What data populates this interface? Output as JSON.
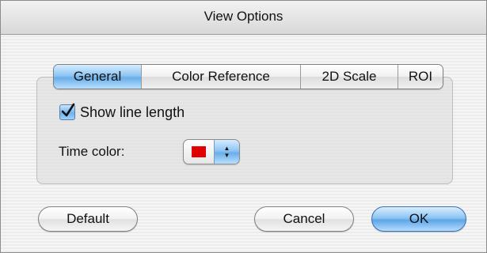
{
  "window": {
    "title": "View Options"
  },
  "tabs": [
    {
      "label": "General",
      "active": true
    },
    {
      "label": "Color Reference",
      "active": false
    },
    {
      "label": "2D Scale",
      "active": false
    },
    {
      "label": "ROI",
      "active": false
    }
  ],
  "general": {
    "show_line_length": {
      "label": "Show line length",
      "checked": true
    },
    "time_color": {
      "label": "Time color:",
      "value_color": "#e00000"
    }
  },
  "buttons": {
    "default": "Default",
    "cancel": "Cancel",
    "ok": "OK"
  },
  "colors": {
    "accent": "#6aaee8"
  }
}
